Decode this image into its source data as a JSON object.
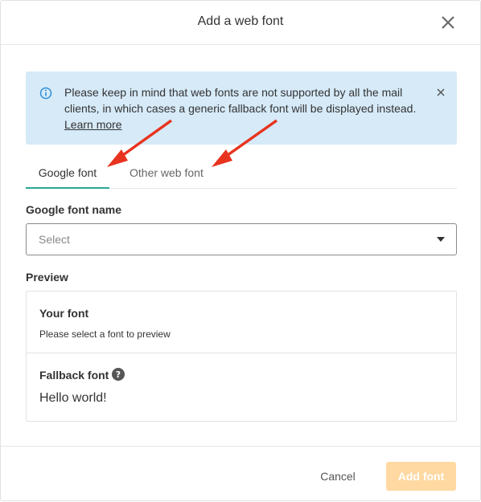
{
  "dialog": {
    "title": "Add a web font",
    "close_icon": "close-icon"
  },
  "banner": {
    "message": "Please keep in mind that web fonts are not supported by all the mail clients, in which cases a generic fallback font will be displayed instead.",
    "link": "Learn more",
    "info_icon": "info-icon",
    "dismiss_icon": "close-icon"
  },
  "tabs": [
    {
      "label": "Google font",
      "active": true
    },
    {
      "label": "Other web font",
      "active": false
    }
  ],
  "form": {
    "font_name_label": "Google font name",
    "select_placeholder": "Select"
  },
  "preview": {
    "label": "Preview",
    "your_font_title": "Your font",
    "your_font_hint": "Please select a font to preview",
    "fallback_title": "Fallback font",
    "fallback_sample": "Hello world!"
  },
  "footer": {
    "cancel": "Cancel",
    "add": "Add font"
  },
  "colors": {
    "accent": "#2aa897",
    "banner_bg": "#d6eaf8",
    "info_blue": "#2f8fd8",
    "arrow_red": "#e8341f",
    "add_disabled": "#ffd9a1"
  }
}
